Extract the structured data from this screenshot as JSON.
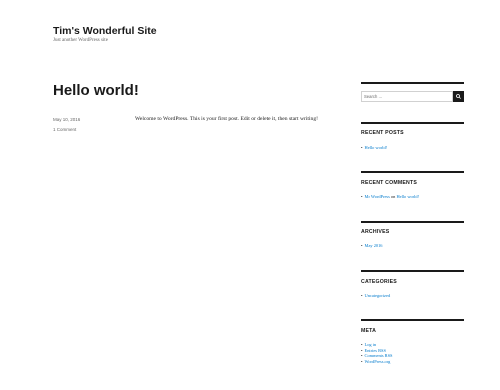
{
  "site": {
    "title": "Tim's Wonderful Site",
    "description": "Just another WordPress site"
  },
  "post": {
    "title": "Hello world!",
    "date": "May 10, 2016",
    "comments": "1 Comment",
    "content": "Welcome to WordPress. This is your first post. Edit or delete it, then start writing!"
  },
  "sidebar": {
    "search": {
      "placeholder": "Search …",
      "icon": "search-icon"
    },
    "recent_posts": {
      "title": "RECENT POSTS",
      "items": [
        "Hello world!"
      ]
    },
    "recent_comments": {
      "title": "RECENT COMMENTS",
      "author": "Mr WordPress",
      "on": "on",
      "post": "Hello world!"
    },
    "archives": {
      "title": "ARCHIVES",
      "items": [
        "May 2016"
      ]
    },
    "categories": {
      "title": "CATEGORIES",
      "items": [
        "Uncategorized"
      ]
    },
    "meta": {
      "title": "META",
      "items": [
        "Log in",
        "Entries RSS",
        "Comments RSS",
        "WordPress.org"
      ]
    }
  },
  "colors": {
    "link": "#007acc",
    "text": "#1a1a1a",
    "muted": "#686868"
  }
}
